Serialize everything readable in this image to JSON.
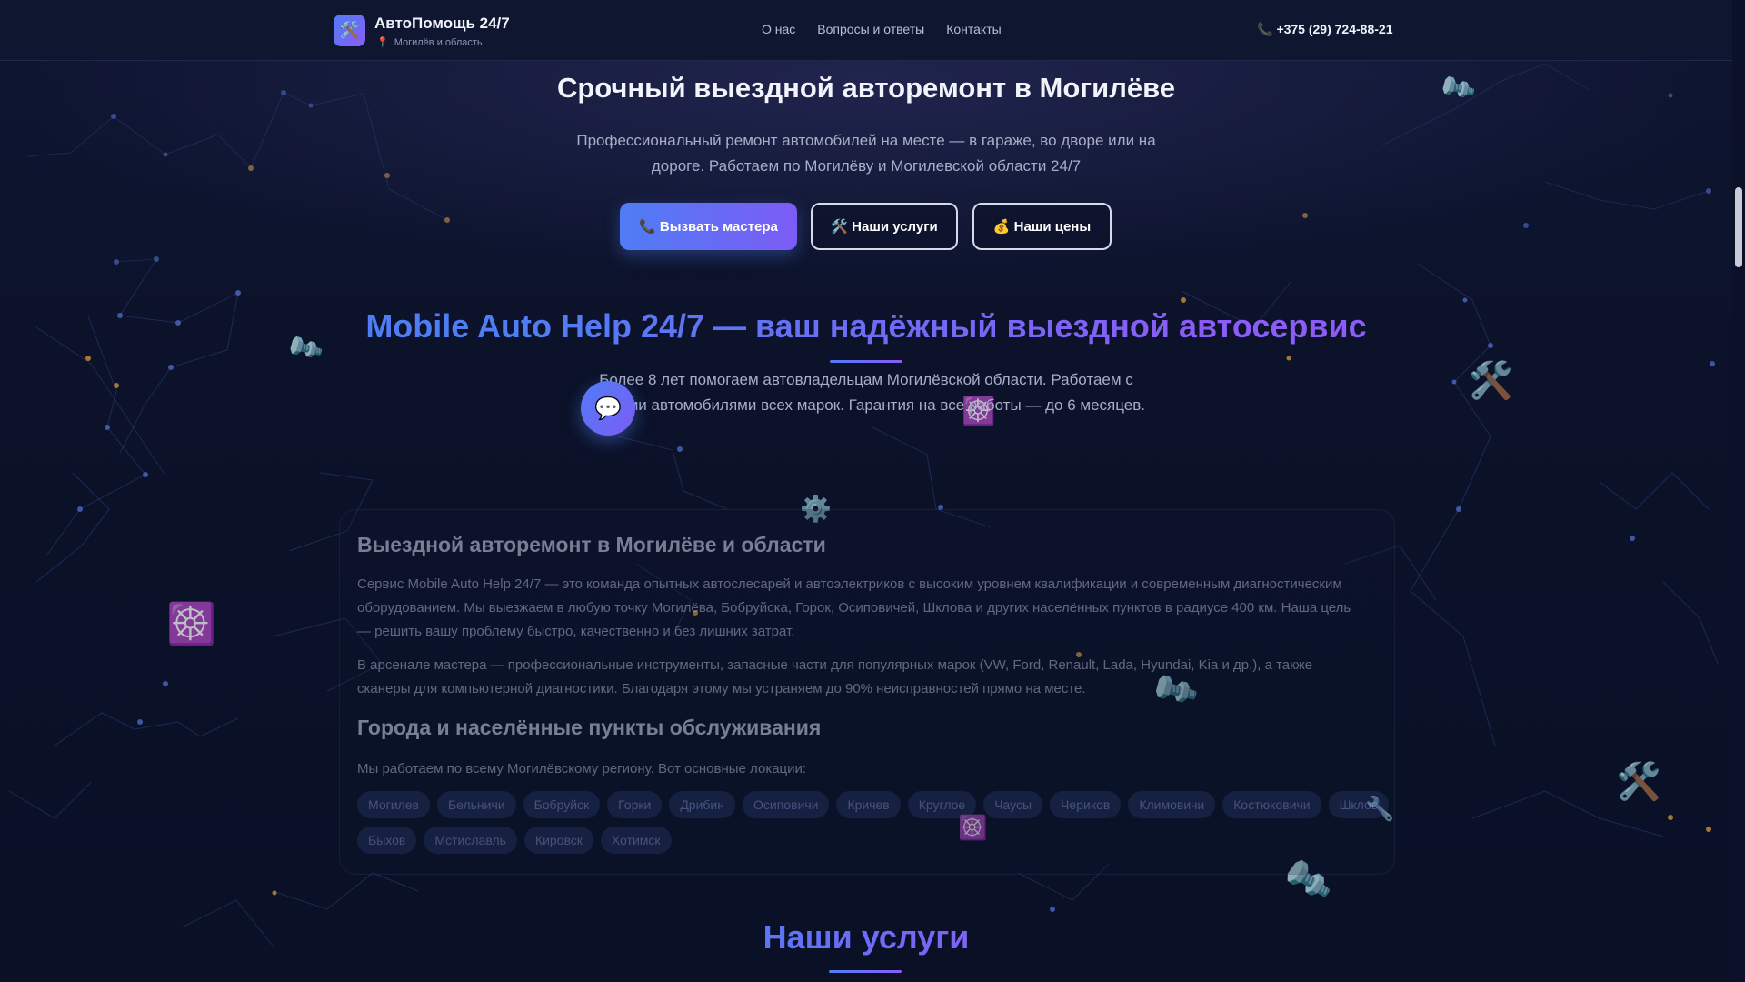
{
  "header": {
    "brand_name": "АвтоПомощь 24/7",
    "brand_location": "Могилёв и область",
    "logo_icon": "🛠️",
    "nav": [
      "О нас",
      "Вопросы и ответы",
      "Контакты"
    ],
    "phone": "+375 (29) 724-88-21"
  },
  "hero": {
    "title": "Срочный выездной авторемонт в Могилёве",
    "subtitle": "Профессиональный ремонт автомобилей на месте — в гараже, во дворе или на дороге. Работаем по Могилёву и Могилевской области 24/7",
    "buttons": {
      "call": "📞 Вызвать мастера",
      "services": "🛠️ Наши услуги",
      "prices": "💰 Наши цены"
    }
  },
  "about": {
    "title": "Mobile Auto Help 24/7 — ваш надёжный выездной автосервис",
    "subtitle": "Более 8 лет помогаем автовладельцам Могилёвской области. Работаем с любыми автомобилями всех марок. Гарантия на все работы — до 6 месяцев."
  },
  "card": {
    "heading1": "Выездной авторемонт в Могилёве и области",
    "paragraph1": "Сервис Mobile Auto Help 24/7 — это команда опытных автослесарей и автоэлектриков с высоким уровнем квалификации и современным диагностическим оборудованием. Мы выезжаем в любую точку Могилёва, Бобруйска, Горок, Осиповичей, Шклова и других населённых пунктов в радиусе 400 км. Наша цель — решить вашу проблему быстро, качественно и без лишних затрат.",
    "paragraph2": "В арсенале мастера — профессиональные инструменты, запасные части для популярных марок (VW, Ford, Renault, Lada, Hyundai, Kia и др.), а также сканеры для компьютерной диагностики. Благодаря этому мы устраняем до 90% неисправностей прямо на месте.",
    "heading2": "Города и населённые пункты обслуживания",
    "paragraph3": "Мы работаем по всему Могилёвскому региону. Вот основные локации:",
    "cities": [
      "Могилев",
      "Бельничи",
      "Бобруйск",
      "Горки",
      "Дрибин",
      "Осиповичи",
      "Кричев",
      "Круглое",
      "Чаусы",
      "Чериков",
      "Климовичи",
      "Костюковичи",
      "Шклов",
      "Быхов",
      "Мстиславль",
      "Кировск",
      "Хотимск"
    ]
  },
  "services": {
    "title": "Наши услуги"
  },
  "chat": {
    "icon": "💬"
  },
  "colors": {
    "accent_blue": "#4f7df5",
    "accent_purple": "#8b5cf6",
    "background": "#0b1229"
  }
}
